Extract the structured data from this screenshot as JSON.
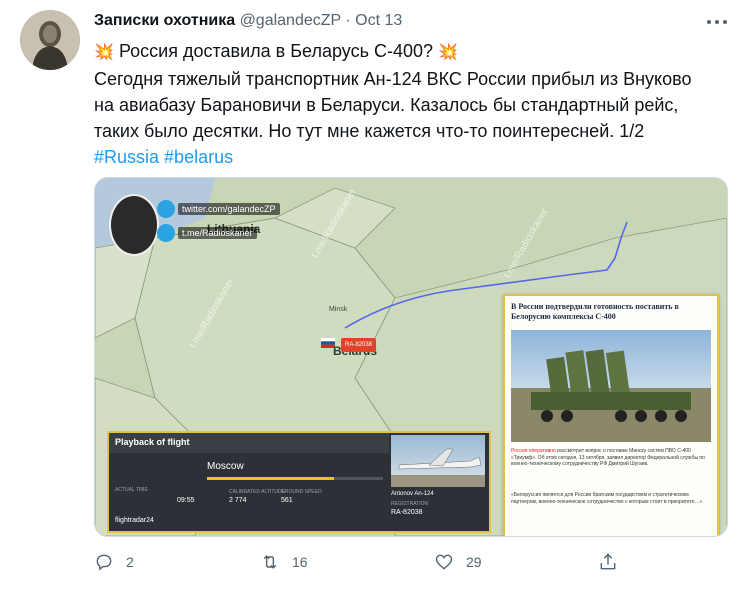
{
  "tweet": {
    "author_name": "Записки охотника",
    "handle": "@galandecZP",
    "separator": "·",
    "date": "Oct 13",
    "title_line": "Россия доставила в Беларусь С-400?",
    "body_line1": "Сегодня тяжелый транспортник Ан-124 ВКС России прибыл из Внуково",
    "body_line2": "на авиабазу Барановичи в Беларуси. Казалось бы  стандартный рейс,",
    "body_line3": "таких было десятки. Но тут мне кажется что-то поинтересней. 1/2",
    "hashtag1": "#Russia",
    "hashtag2": "#belarus",
    "emoji": "💥"
  },
  "media": {
    "twitter_handle": "twitter.com/galandecZP",
    "telegram_handle": "t.me/Radioskaner",
    "watermark": "t.me/Radioskaner",
    "map_labels": {
      "lithuania": "Lithuania",
      "belarus": "Belarus",
      "minsk": "Minsk"
    },
    "flight_tag": "RA-82038",
    "article": {
      "headline": "В России подтвердили готовность поставить в Белорусию комплексы С-400",
      "paragraph_highlight": "Россия оперативно",
      "paragraph": "рассмотрит вопрос о поставке Минску систем ПВО С-400 «Триумф». Об этом сегодня, 13 октября, заявил директор Федеральной службы по военно-техническому сотрудничеству РФ Дмитрий Шугаев.",
      "quote": "«Белоруссия является для России братским государством и стратегическим партнером, военно-техническое сотрудничество с которым стоит в приоритете…»"
    },
    "playback": {
      "title": "Playback of flight",
      "origin": "Moscow",
      "label_status": "ACTUAL TIME",
      "time": "09:55",
      "altitude_label": "CALIBRATED ALTITUDE",
      "altitude": "2 774",
      "speed_label": "GROUND SPEED",
      "speed": "561",
      "aircraft": "Antonov An-124",
      "registration_label": "REGISTRATION",
      "registration": "RA-82038",
      "brand": "flightradar24",
      "progress": 0.72
    }
  },
  "actions": {
    "replies": "2",
    "retweets": "16",
    "likes": "29"
  },
  "colors": {
    "link": "#1d9bf0",
    "muted": "#536471",
    "flight_path": "#5566ee",
    "highlight_frame": "#e2c04a"
  }
}
